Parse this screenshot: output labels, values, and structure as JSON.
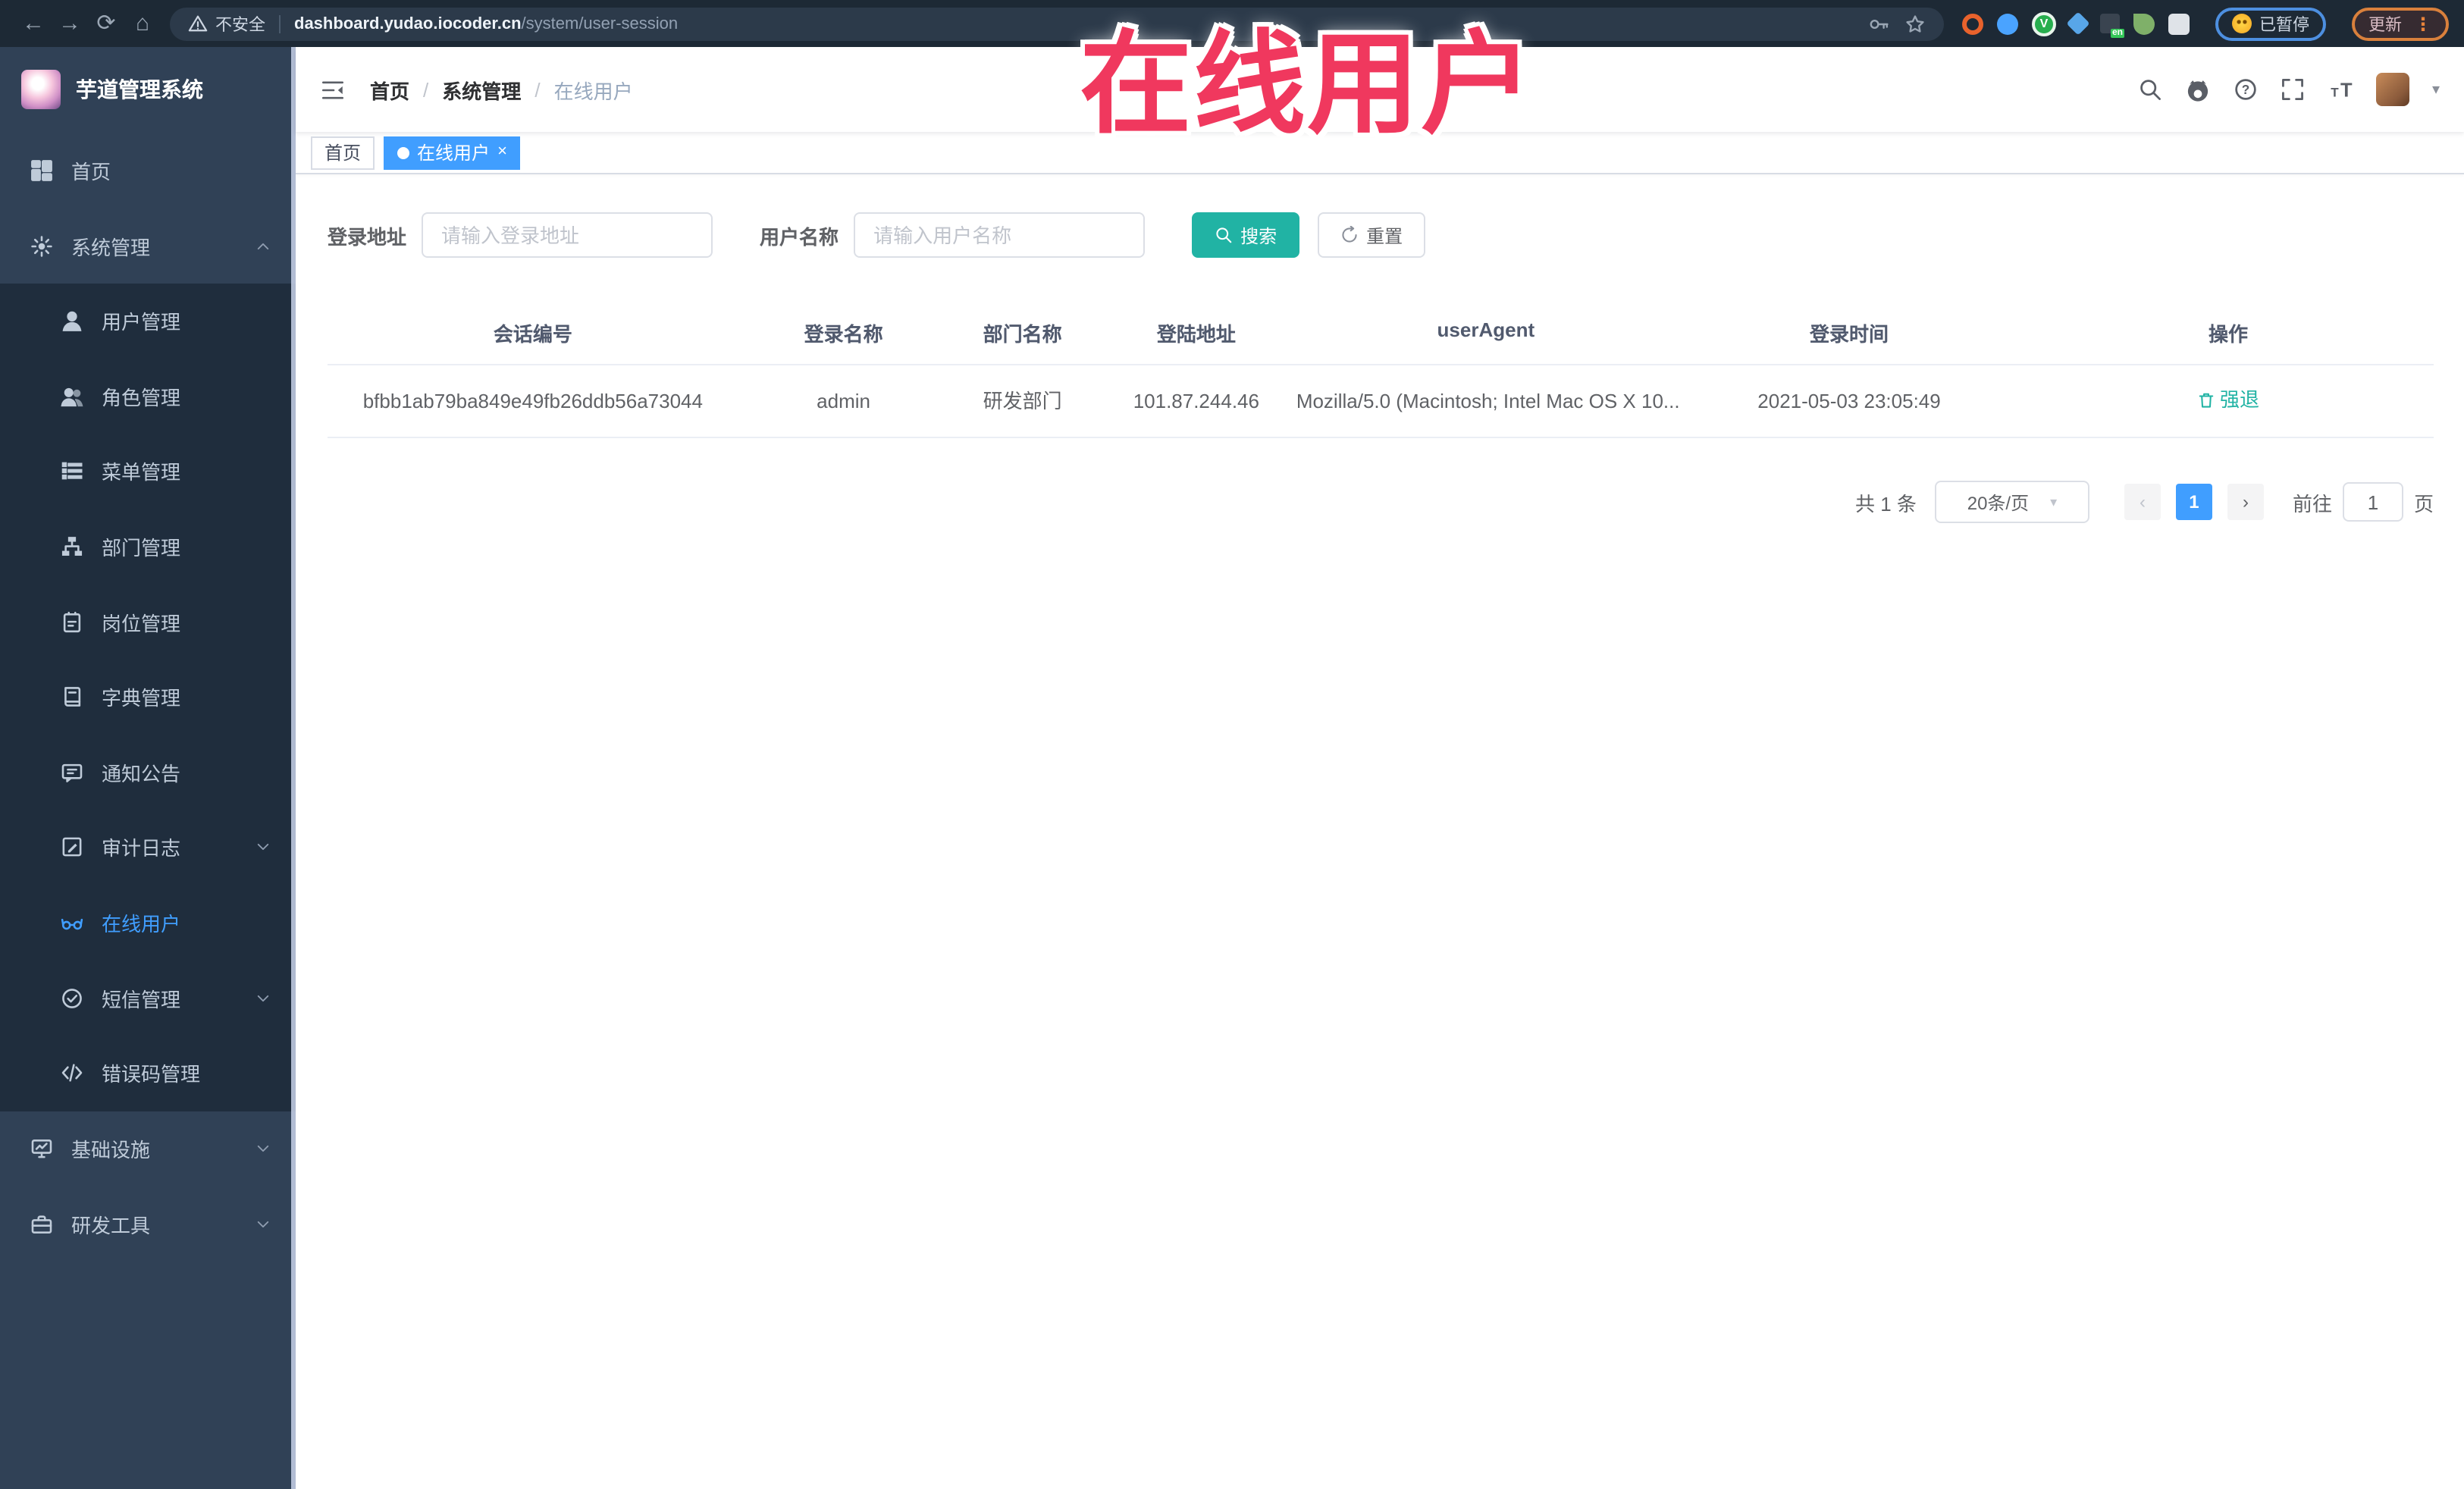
{
  "browser": {
    "security_label": "不安全",
    "url_host": "dashboard.yudao.iocoder.cn",
    "url_path": "/system/user-session",
    "paused_label": "已暂停",
    "update_label": "更新"
  },
  "sidebar": {
    "title": "芋道管理系统",
    "items": [
      {
        "label": "首页"
      },
      {
        "label": "系统管理"
      },
      {
        "label": "用户管理"
      },
      {
        "label": "角色管理"
      },
      {
        "label": "菜单管理"
      },
      {
        "label": "部门管理"
      },
      {
        "label": "岗位管理"
      },
      {
        "label": "字典管理"
      },
      {
        "label": "通知公告"
      },
      {
        "label": "审计日志"
      },
      {
        "label": "在线用户"
      },
      {
        "label": "短信管理"
      },
      {
        "label": "错误码管理"
      },
      {
        "label": "基础设施"
      },
      {
        "label": "研发工具"
      }
    ]
  },
  "breadcrumb": {
    "0": "首页",
    "1": "系统管理",
    "2": "在线用户"
  },
  "tabs": [
    {
      "label": "首页"
    },
    {
      "label": "在线用户"
    }
  ],
  "search": {
    "addr_label": "登录地址",
    "addr_placeholder": "请输入登录地址",
    "name_label": "用户名称",
    "name_placeholder": "请输入用户名称",
    "search_btn": "搜索",
    "reset_btn": "重置"
  },
  "table": {
    "headers": [
      "会话编号",
      "登录名称",
      "部门名称",
      "登陆地址",
      "userAgent",
      "登录时间",
      "操作"
    ],
    "rows": [
      {
        "session": "bfbb1ab79ba849e49fb26ddb56a73044",
        "login_name": "admin",
        "dept": "研发部门",
        "addr": "101.87.244.46",
        "user_agent": "Mozilla/5.0 (Macintosh; Intel Mac OS X 10...",
        "login_time": "2021-05-03 23:05:49",
        "action": "强退"
      }
    ]
  },
  "pagination": {
    "total": "共 1 条",
    "page_size": "20条/页",
    "current_page": "1",
    "goto_label": "前往",
    "goto_value": "1",
    "page_unit": "页"
  },
  "watermark": {
    "text": "在线用户"
  },
  "colors": {
    "accent": "#409EFF",
    "search_button": "#21b3a4",
    "action_link": "#21b3a4",
    "watermark": "#f0385e",
    "sidebar_bg": "#304156",
    "submenu_bg": "#1f2d3d"
  }
}
